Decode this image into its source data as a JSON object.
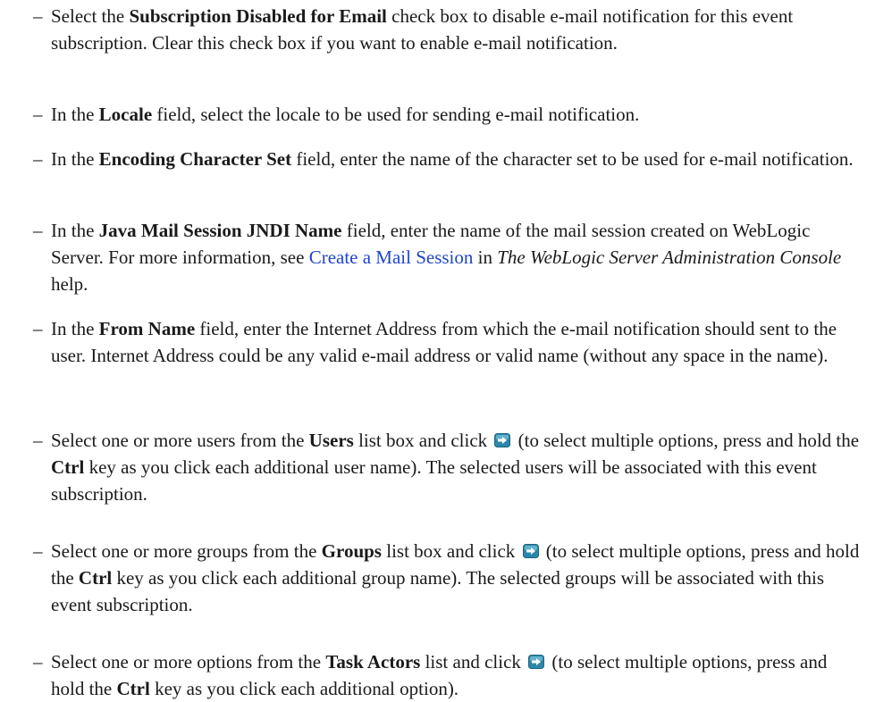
{
  "bullets": [
    {
      "s1": "Select the ",
      "b1": "Subscription Disabled for Email",
      "s2": " check box to disable e-mail notification for this event subscription. Clear this check box if you want to enable e-mail notification."
    },
    {
      "s1": "In the ",
      "b1": "Locale",
      "s2": " field, select the locale to be used for sending e-mail notification."
    },
    {
      "s1": "In the ",
      "b1": "Encoding Character Set",
      "s2": " field, enter the name of the character set to be used for e-mail notification."
    },
    {
      "s1": "In the ",
      "b1": "Java Mail Session JNDI Name",
      "s2": " field, enter the name of the mail session created on WebLogic Server. For more information, see ",
      "link": "Create a Mail Session",
      "s3": " in ",
      "i1": "The WebLogic Server Administration Console",
      "s4": " help."
    },
    {
      "s1": "In the ",
      "b1": "From Name",
      "s2": " field, enter the Internet Address from which the e-mail notification should sent to the user. Internet Address could be any valid e-mail address or valid name (without any space in the name)."
    },
    {
      "s1": "Select one or more users from the ",
      "b1": "Users",
      "s2": " list box and click ",
      "s3": " (to select multiple options, press and hold the ",
      "b2": "Ctrl",
      "s4": " key as you click each additional user name). The selected users will be associated with this event subscription."
    },
    {
      "s1": "Select one or more groups from the ",
      "b1": "Groups",
      "s2": " list box and click ",
      "s3": " (to select multiple options, press and hold the ",
      "b2": "Ctrl",
      "s4": " key as you click each additional group name). The selected groups will be associated with this event subscription."
    },
    {
      "s1": "Select one or more options from the ",
      "b1": "Task Actors",
      "s2": " list and click ",
      "s3": " (to select multiple options, press and hold the ",
      "b2": "Ctrl",
      "s4": " key as you click each additional option)."
    }
  ],
  "dash": "–",
  "icons": {
    "move": "move-right-arrow-icon"
  },
  "colors": {
    "link": "#1f45cc",
    "icon_bg": "#2b88a8"
  }
}
